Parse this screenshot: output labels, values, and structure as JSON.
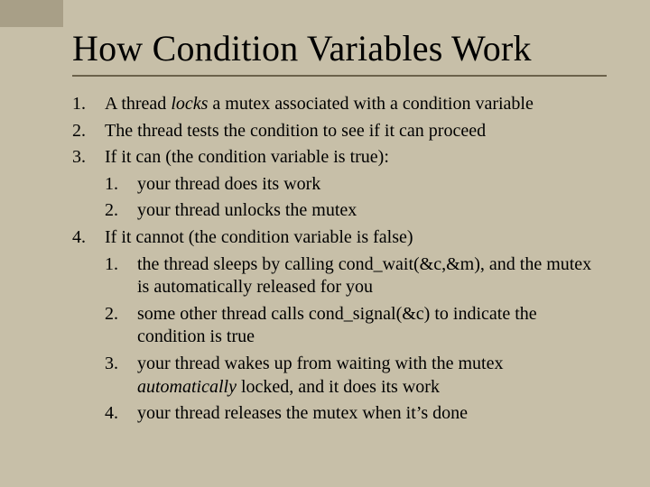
{
  "title": "How Condition Variables Work",
  "items": {
    "n1": "1.",
    "t1a": "A thread ",
    "t1b": "locks",
    "t1c": " a mutex associated with a condition variable",
    "n2": "2.",
    "t2": "The thread tests the condition to see if it can proceed",
    "n3": "3.",
    "t3": "If it can (the condition variable is true):",
    "n3_1": "1.",
    "t3_1": "your thread does its work",
    "n3_2": "2.",
    "t3_2": "your thread unlocks the mutex",
    "n4": "4.",
    "t4": "If it cannot (the condition variable is false)",
    "n4_1": "1.",
    "t4_1": "the thread sleeps by calling cond_wait(&c,&m), and the mutex is automatically released for you",
    "n4_2": "2.",
    "t4_2": "some other thread calls cond_signal(&c) to indicate the condition is true",
    "n4_3": "3.",
    "t4_3a": "your thread wakes up from waiting with the mutex ",
    "t4_3b": "automatically",
    "t4_3c": " locked, and it does its work",
    "n4_4": "4.",
    "t4_4": "your thread releases the mutex when it’s done"
  }
}
